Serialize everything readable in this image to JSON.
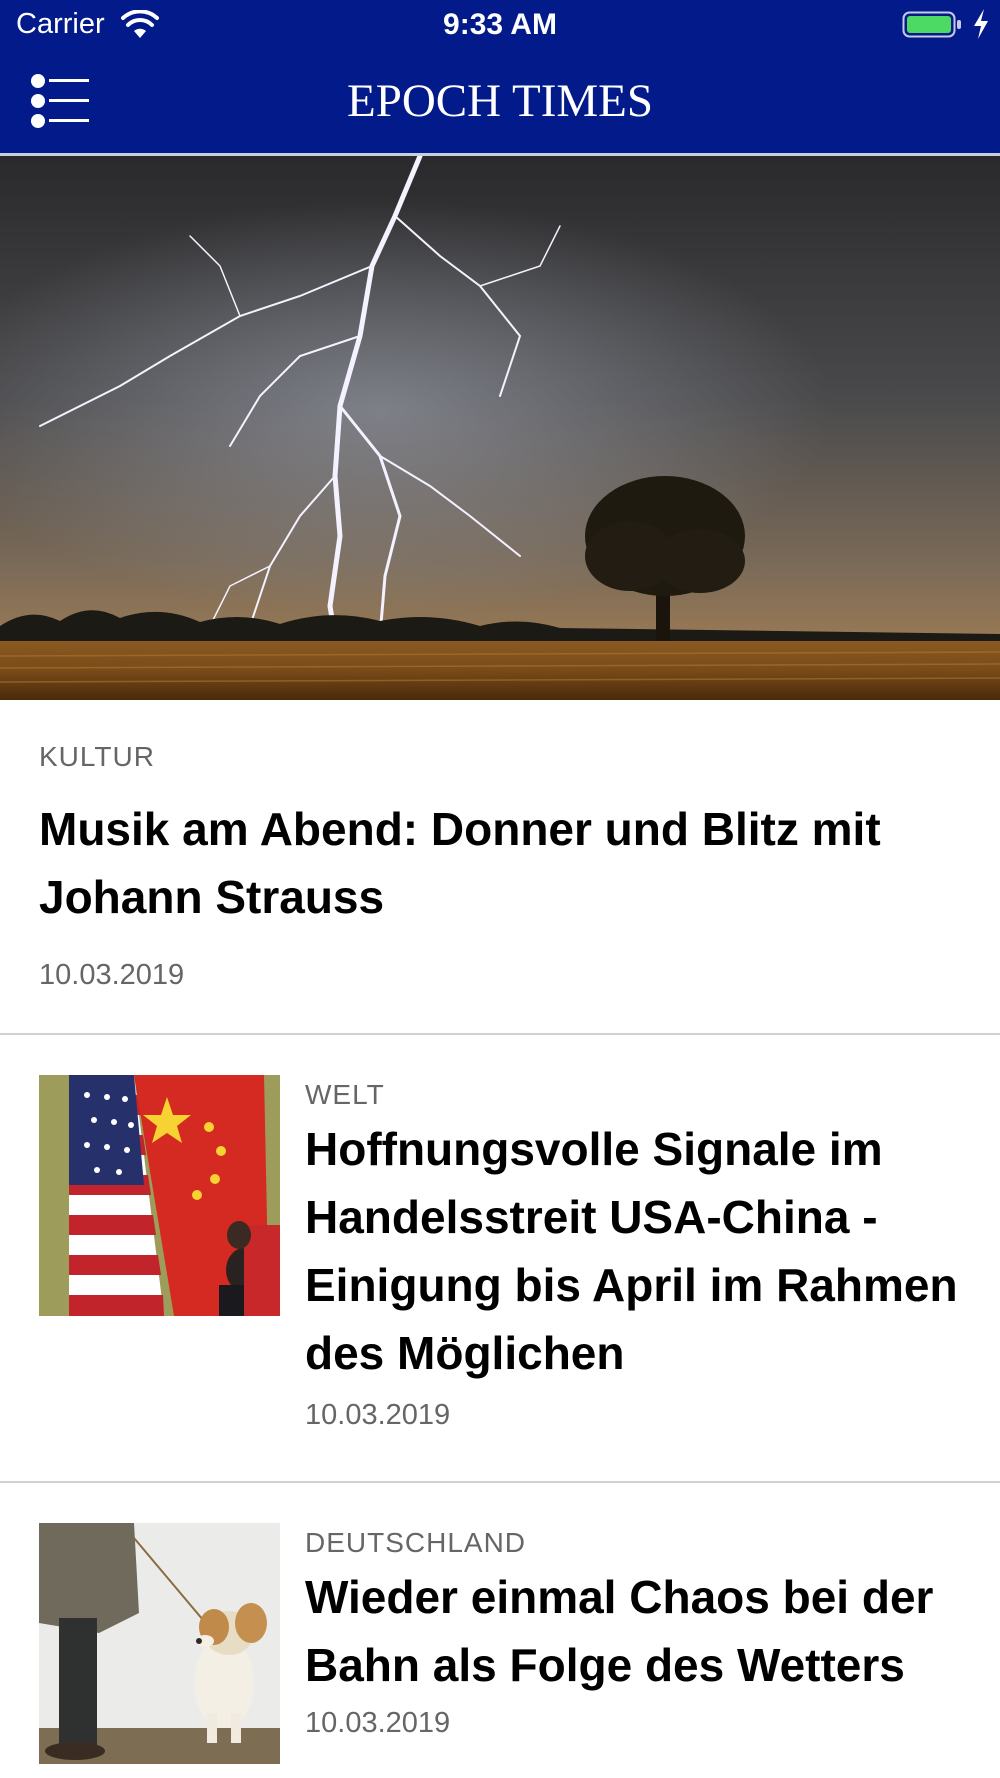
{
  "status_bar": {
    "carrier": "Carrier",
    "time": "9:33 AM",
    "battery_color": "#4cd964"
  },
  "header": {
    "brand": "EPOCH TIMES",
    "background": "#021a8a",
    "menu_icon": "list-menu-icon"
  },
  "hero": {
    "image": "lightning-storm-field-photo",
    "category": "KULTUR",
    "title": "Musik am Abend: Donner und Blitz mit Johann Strauss",
    "date": "10.03.2019"
  },
  "articles": [
    {
      "image": "usa-china-flags-photo",
      "category": "WELT",
      "title": "Hoffnungsvolle Signale im Handelsstreit USA-China - Einigung bis April im Rahmen des Möglichen",
      "date": "10.03.2019"
    },
    {
      "image": "dog-on-leash-photo",
      "category": "DEUTSCHLAND",
      "title": "Wieder einmal Chaos bei der Bahn als Folge des Wetters",
      "date": "10.03.2019"
    }
  ]
}
